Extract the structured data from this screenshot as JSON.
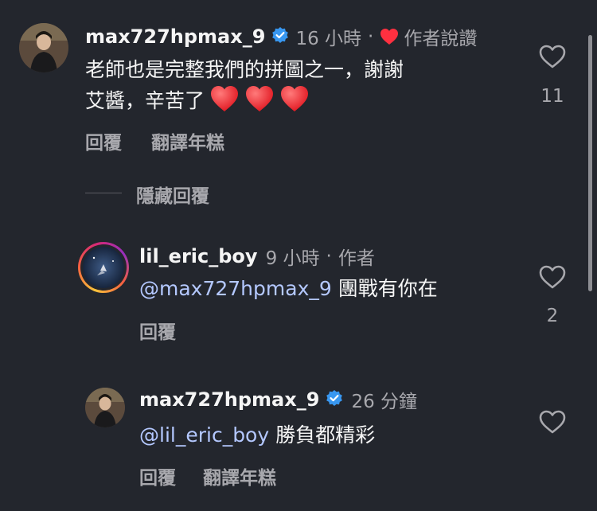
{
  "comment1": {
    "username": "max727hpmax_9",
    "time": "16 小時",
    "dot": "·",
    "author_liked": "作者說讚",
    "text_line1": "老師也是完整我們的拼圖之一，謝謝",
    "text_line2": "艾醬，辛苦了",
    "emoji_hearts": [
      "red-heart",
      "red-heart",
      "red-heart"
    ],
    "like_count": "11",
    "reply_label": "回覆",
    "translate_label": "翻譯年糕"
  },
  "hide_replies": {
    "label": "隱藏回覆"
  },
  "reply1": {
    "username": "lil_eric_boy",
    "time": "9 小時",
    "dot": "·",
    "author_tag": "作者",
    "mention": "@max727hpmax_9",
    "text": " 團戰有你在",
    "like_count": "2",
    "reply_label": "回覆"
  },
  "reply2": {
    "username": "max727hpmax_9",
    "time": "26 分鐘",
    "mention": "@lil_eric_boy",
    "text": " 勝負都精彩",
    "reply_label": "回覆",
    "translate_label": "翻譯年糕"
  },
  "colors": {
    "background": "#23262d",
    "verified_blue": "#3897f0",
    "heart_red": "#ff3040",
    "mention": "#b4c8ff",
    "muted": "#a8a8ad"
  },
  "icons": {
    "like": "heart-outline-icon",
    "verified": "verified-badge-icon",
    "liked_by_author": "red-heart-icon"
  }
}
